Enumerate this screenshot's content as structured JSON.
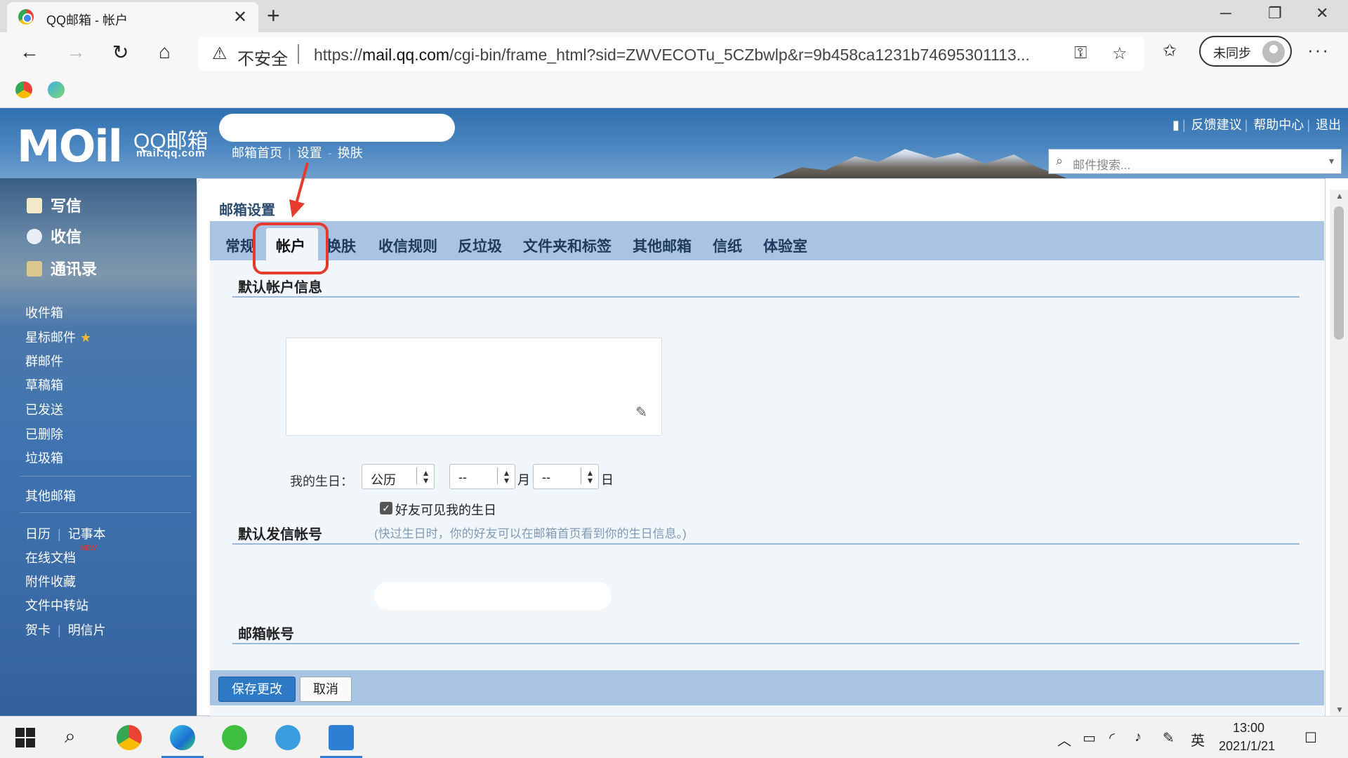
{
  "browser": {
    "tab_title": "QQ邮箱 - 帐户",
    "security_label": "不安全",
    "url_prefix": "https://",
    "url_domain": "mail.qq.com",
    "url_path": "/cgi-bin/frame_html?sid=ZWVECOTu_5CZbwlp&r=9b458ca1231b74695301113...",
    "sync_label": "未同步"
  },
  "header": {
    "logo_mail": "MOil",
    "logo_qq": "QQ邮箱",
    "logo_domain": "mail.qq.com",
    "links": [
      "邮箱首页",
      "设置",
      "换肤"
    ],
    "top_links": [
      "反馈建议",
      "帮助中心",
      "退出"
    ],
    "search_placeholder": "邮件搜索..."
  },
  "sidebar": {
    "main": [
      "写信",
      "收信",
      "通讯录"
    ],
    "folders": [
      "收件箱",
      "星标邮件",
      "群邮件",
      "草稿箱",
      "已发送",
      "已删除",
      "垃圾箱"
    ],
    "other_mail": "其他邮箱",
    "tools_row1": [
      "日历",
      "记事本"
    ],
    "online_docs": "在线文档",
    "new_badge": "NEW",
    "attachments": "附件收藏",
    "file_transfer": "文件中转站",
    "cards": [
      "贺卡",
      "明信片"
    ]
  },
  "settings": {
    "title": "邮箱设置",
    "tabs": [
      "常规",
      "帐户",
      "换肤",
      "收信规则",
      "反垃圾",
      "文件夹和标签",
      "其他邮箱",
      "信纸",
      "体验室"
    ],
    "active_tab": "帐户",
    "section_default_info": "默认帐户信息",
    "birthday_label": "我的生日：",
    "calendar_value": "公历",
    "month_value": "--",
    "month_unit": "月",
    "day_value": "--",
    "day_unit": "日",
    "friends_see_birthday": "好友可见我的生日",
    "friends_see_checked": true,
    "birthday_hint": "(快过生日时，你的好友可以在邮箱首页看到你的生日信息。)",
    "section_default_sender": "默认发信帐号",
    "section_mail_account": "邮箱帐号",
    "save_button": "保存更改",
    "cancel_button": "取消"
  },
  "taskbar": {
    "ime": "英",
    "time": "13:00",
    "date": "2021/1/21"
  },
  "colors": {
    "header_blue": "#3f79b6",
    "tab_bar": "#a9c4e2",
    "annotation_red": "#e53a2c",
    "save_blue": "#2d79c4"
  }
}
